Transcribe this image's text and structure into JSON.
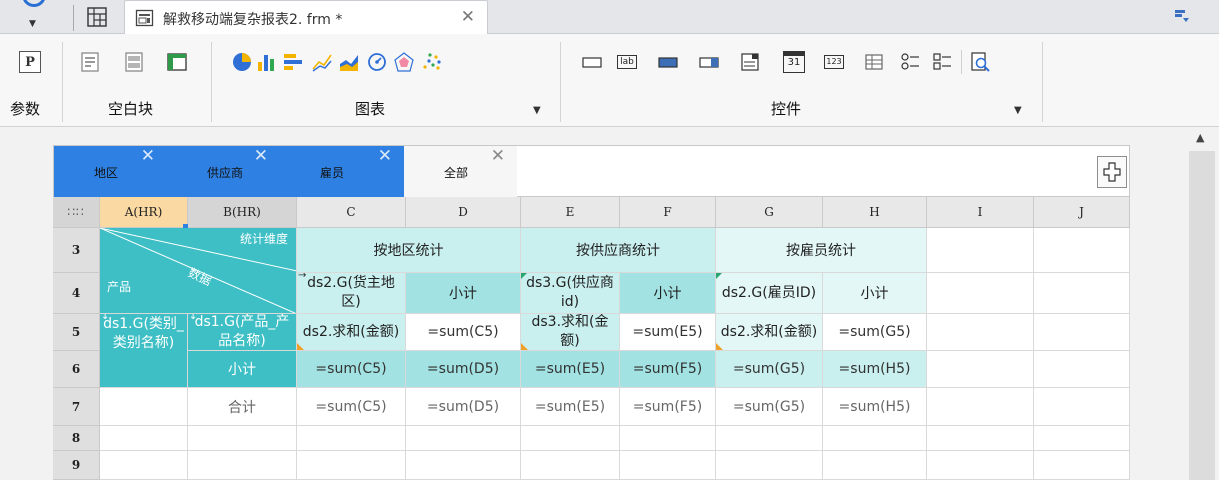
{
  "tabbar": {
    "tab_title": "解救移动端复杂报表2. frm *"
  },
  "ribbon": {
    "param_label": "参数",
    "param_button_text": "P",
    "blank_label": "空白块",
    "chart_label": "图表",
    "widget_label": "控件",
    "widget_text_icons": [
      "lab",
      "31",
      "123"
    ]
  },
  "params": {
    "tabs": [
      {
        "label": "地区",
        "active": true
      },
      {
        "label": "供应商",
        "active": true
      },
      {
        "label": "雇员",
        "active": true
      },
      {
        "label": "全部",
        "active": false
      }
    ]
  },
  "grid": {
    "corner": "∷∷",
    "columns": [
      "A(HR)",
      "B(HR)",
      "C",
      "D",
      "E",
      "F",
      "G",
      "H",
      "I",
      "J"
    ],
    "rows": [
      "3",
      "4",
      "5",
      "6",
      "7",
      "8",
      "9"
    ],
    "header": {
      "slash_top": "统计维度",
      "slash_mid": "数据",
      "slash_bottom": "产品",
      "group_region": "按地区统计",
      "group_supplier": "按供应商统计",
      "group_employee": "按雇员统计"
    },
    "row4": {
      "c": "ds2.G(货主地区)",
      "d": "小计",
      "e": "ds3.G(供应商id)",
      "f": "小计",
      "g": "ds2.G(雇员ID)",
      "h": "小计"
    },
    "row5": {
      "a": "ds1.G(类别_类别名称)",
      "b": "ds1.G(产品_产品名称)",
      "c": "ds2.求和(金额)",
      "d": "=sum(C5)",
      "e": "ds3.求和(金额)",
      "f": "=sum(E5)",
      "g": "ds2.求和(金额)",
      "h": "=sum(G5)"
    },
    "row6": {
      "b": "小计",
      "c": "=sum(C5)",
      "d": "=sum(D5)",
      "e": "=sum(E5)",
      "f": "=sum(F5)",
      "g": "=sum(G5)",
      "h": "=sum(H5)"
    },
    "row7": {
      "b": "合计",
      "c": "=sum(C5)",
      "d": "=sum(D5)",
      "e": "=sum(E5)",
      "f": "=sum(F5)",
      "g": "=sum(G5)",
      "h": "=sum(H5)"
    }
  },
  "colors": {
    "accent_blue": "#2e81e3",
    "teal_dark": "#3dbfc5",
    "teal_mid": "#a2e2e2",
    "teal_light": "#c9efef",
    "teal_pale": "#e2f7f6",
    "selected_header": "#fbd9a2"
  }
}
